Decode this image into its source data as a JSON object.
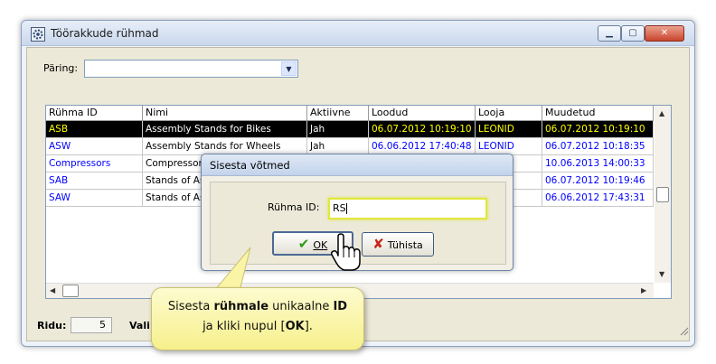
{
  "window": {
    "title": "Töörakkude rühmad",
    "minimize_icon": "minimize-icon",
    "maximize_icon": "maximize-icon",
    "close_icon": "close-icon"
  },
  "query": {
    "label": "Päring:",
    "value": ""
  },
  "table": {
    "columns": [
      "Rühma ID",
      "Nimi",
      "Aktiivne",
      "Loodud",
      "Looja",
      "Muudetud"
    ],
    "rows": [
      [
        "ASB",
        "Assembly Stands for Bikes",
        "Jah",
        "06.07.2012 10:19:10",
        "LEONID",
        "06.07.2012 10:19:10"
      ],
      [
        "ASW",
        "Assembly Stands for Wheels",
        "Jah",
        "06.06.2012 17:40:48",
        "LEONID",
        "06.07.2012 10:18:35"
      ],
      [
        "Compressors",
        "Compressor",
        "",
        "",
        "",
        "10.06.2013 14:00:33"
      ],
      [
        "SAB",
        "Stands of As",
        "",
        "",
        "",
        "06.07.2012 10:19:46"
      ],
      [
        "SAW",
        "Stands of As",
        "",
        "",
        "",
        "06.06.2012 17:43:31"
      ]
    ]
  },
  "status": {
    "rows_label": "Ridu:",
    "rows_count": "5",
    "right_label": "Vali"
  },
  "dialog": {
    "title": "Sisesta võtmed",
    "field_label": "Rühma ID:",
    "field_value": "RS",
    "ok_label": "OK",
    "cancel_label": "Tühista"
  },
  "callout": {
    "t1": "Sisesta ",
    "t2": "rühmale",
    "t3": " unikaalne ",
    "t4": "ID",
    "t5": "ja kliki nupul [",
    "t6": "OK",
    "t7": "]."
  },
  "colors": {
    "id_blue": "#0000ff",
    "selected_bg": "#000000",
    "selected_fg": "#ffff00"
  }
}
